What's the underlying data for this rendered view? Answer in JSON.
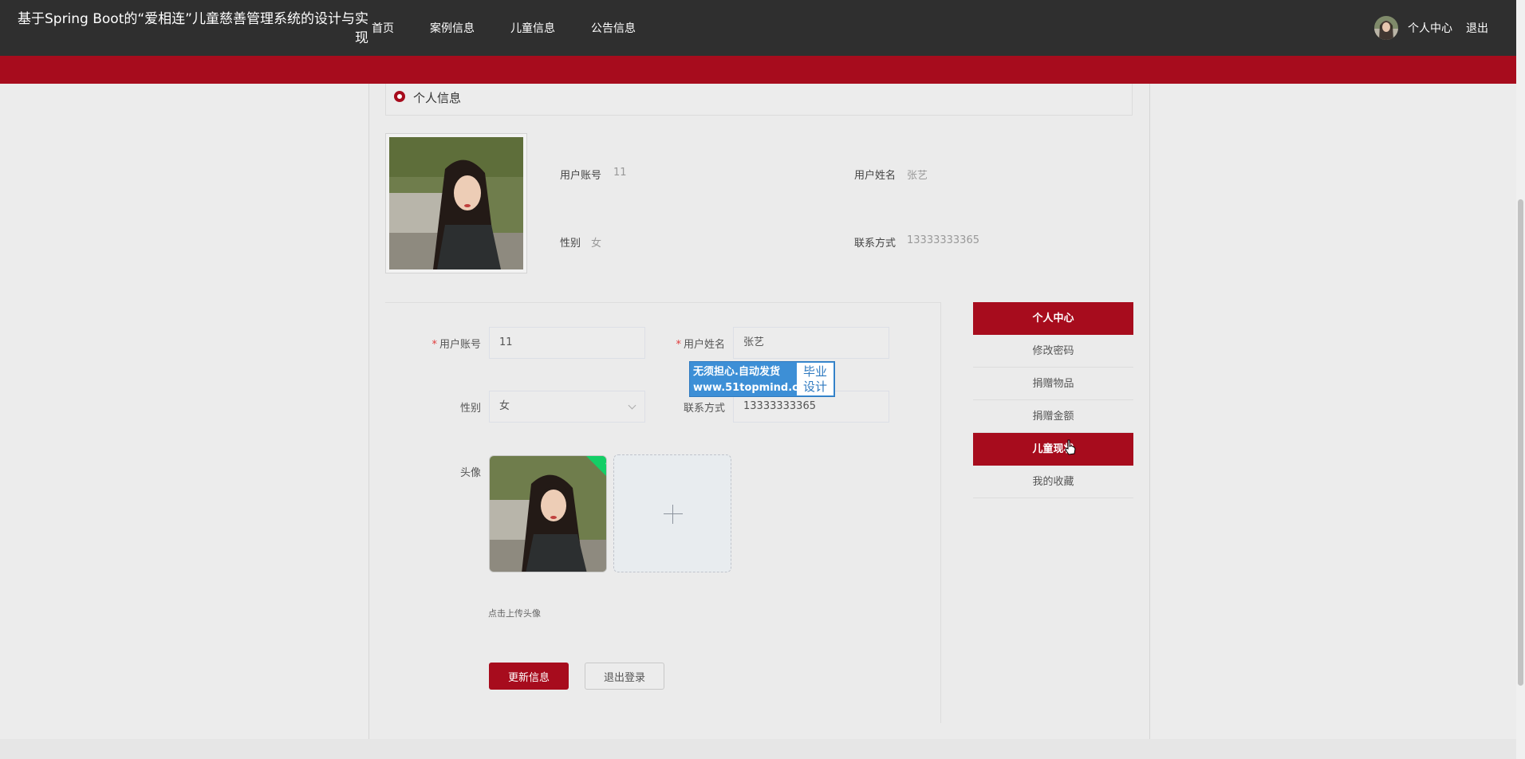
{
  "header": {
    "site_title": "基于Spring Boot的“爱相连”儿童慈善管理系统的设计与实现",
    "nav": [
      "首页",
      "案例信息",
      "儿童信息",
      "公告信息"
    ],
    "user_center": "个人中心",
    "logout": "退出"
  },
  "profile": {
    "section_title": "个人信息",
    "account_label": "用户账号",
    "account_value": "11",
    "name_label": "用户姓名",
    "name_value": "张艺",
    "gender_label": "性别",
    "gender_value": "女",
    "phone_label": "联系方式",
    "phone_value": "13333333365"
  },
  "form": {
    "account_label": "用户账号",
    "account_value": "11",
    "name_label": "用户姓名",
    "name_value": "张艺",
    "gender_label": "性别",
    "gender_value": "女",
    "phone_label": "联系方式",
    "phone_value": "13333333365",
    "avatar_label": "头像",
    "upload_hint": "点击上传头像",
    "update_button": "更新信息",
    "logout_button": "退出登录"
  },
  "side_menu": [
    "个人中心",
    "修改密码",
    "捐赠物品",
    "捐赠金额",
    "儿童现状",
    "我的收藏"
  ],
  "watermark": {
    "line1": "无须担心.自动发货",
    "line2": "www.51topmind.com",
    "badge_line1": "毕业",
    "badge_line2": "设计"
  },
  "colors": {
    "brand": "#a70c1d",
    "topbar": "#2f2f2f",
    "success": "#13ce66"
  }
}
